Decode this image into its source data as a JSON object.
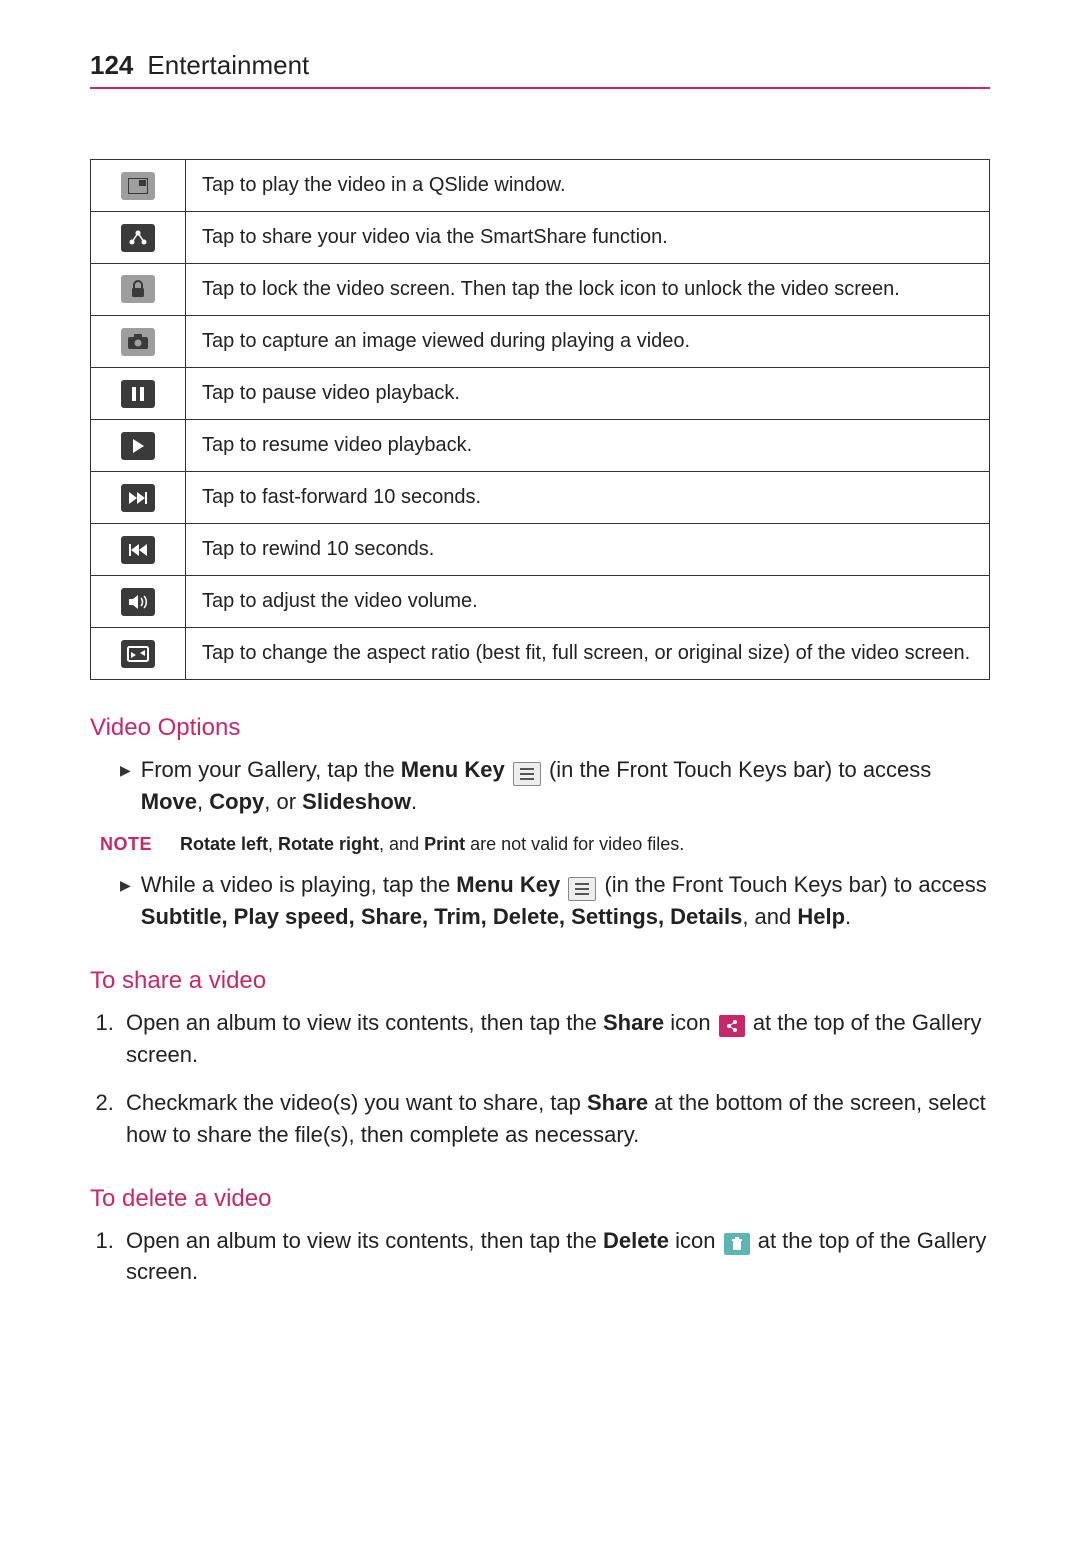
{
  "page_number": "124",
  "section": "Entertainment",
  "icon_rows": [
    {
      "icon": "qslide",
      "desc": "Tap to play the video in a QSlide window."
    },
    {
      "icon": "smartshare",
      "desc": "Tap to share your video via the SmartShare function."
    },
    {
      "icon": "lock",
      "desc": "Tap to lock the video screen. Then tap the lock icon to unlock the video screen."
    },
    {
      "icon": "capture",
      "desc": "Tap to capture an image viewed during playing a video."
    },
    {
      "icon": "pause",
      "desc": "Tap to pause video playback."
    },
    {
      "icon": "play",
      "desc": "Tap to resume video playback."
    },
    {
      "icon": "ffwd",
      "desc": "Tap to fast-forward 10 seconds."
    },
    {
      "icon": "rwd",
      "desc": "Tap to rewind 10 seconds."
    },
    {
      "icon": "volume",
      "desc": "Tap to adjust the video volume."
    },
    {
      "icon": "aspect",
      "desc": "Tap to change the aspect ratio (best fit, full screen, or original size)  of the video screen."
    }
  ],
  "video_options": {
    "heading": "Video Options",
    "bullet1_pre": "From your Gallery, tap the ",
    "bullet1_bold1": "Menu Key",
    "bullet1_mid": " (in the Front Touch Keys bar) to access ",
    "bullet1_bold2": "Move",
    "bullet1_sep1": ", ",
    "bullet1_bold3": "Copy",
    "bullet1_sep2": ", or ",
    "bullet1_bold4": "Slideshow",
    "bullet1_end": ".",
    "note_label": "NOTE",
    "note_b1": "Rotate left",
    "note_s1": ", ",
    "note_b2": "Rotate right",
    "note_s2": ", and ",
    "note_b3": "Print",
    "note_tail": " are not valid for video files.",
    "bullet2_pre": "While a video is playing, tap the ",
    "bullet2_bold1": "Menu Key",
    "bullet2_mid": " (in the Front Touch Keys bar) to access ",
    "bullet2_bold_list": "Subtitle, Play speed, Share, Trim, Delete, Settings, Details",
    "bullet2_sep": ", and ",
    "bullet2_bold_last": "Help",
    "bullet2_end": "."
  },
  "share_video": {
    "heading": "To share a video",
    "step1_pre": "Open an album to view its contents, then tap the ",
    "step1_bold": "Share",
    "step1_mid": " icon ",
    "step1_tail": " at the top of the Gallery screen.",
    "step2_pre": "Checkmark the video(s) you want to share, tap ",
    "step2_bold": "Share",
    "step2_tail": " at the bottom of the screen, select how to share the file(s), then complete as necessary."
  },
  "delete_video": {
    "heading": "To delete a video",
    "step1_pre": "Open an album to view its contents, then tap the ",
    "step1_bold": "Delete",
    "step1_mid": " icon ",
    "step1_tail": " at the top of the Gallery screen."
  }
}
